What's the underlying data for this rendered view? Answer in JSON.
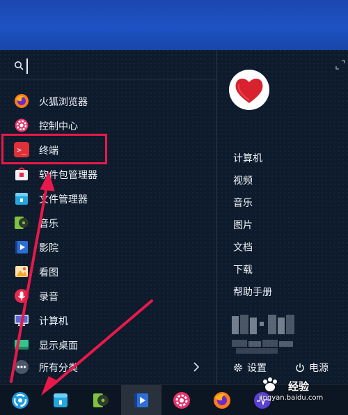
{
  "search": {
    "value": "",
    "placeholder": ""
  },
  "apps": [
    {
      "label": "火狐浏览器",
      "icon": "firefox-icon",
      "color": "#ff7a1a"
    },
    {
      "label": "控制中心",
      "icon": "gear-icon",
      "color": "#e5336b"
    },
    {
      "label": "终端",
      "icon": "terminal-icon",
      "color": "#e0303a"
    },
    {
      "label": "软件包管理器",
      "icon": "package-icon",
      "color": "#e8e8e8"
    },
    {
      "label": "文件管理器",
      "icon": "folder-icon",
      "color": "#22a6dd"
    },
    {
      "label": "音乐",
      "icon": "music-icon",
      "color": "#7dc241"
    },
    {
      "label": "影院",
      "icon": "movie-icon",
      "color": "#2d6fd8"
    },
    {
      "label": "看图",
      "icon": "image-viewer-icon",
      "color": "#f4a830"
    },
    {
      "label": "录音",
      "icon": "microphone-icon",
      "color": "#e8294d"
    },
    {
      "label": "计算机",
      "icon": "computer-icon",
      "color": "#5a6bd8"
    },
    {
      "label": "显示桌面",
      "icon": "desktop-icon",
      "color": "#36c48a"
    }
  ],
  "all_categories": {
    "label": "所有分类"
  },
  "places": [
    {
      "label": "计算机"
    },
    {
      "label": "视频"
    },
    {
      "label": "音乐"
    },
    {
      "label": "图片"
    },
    {
      "label": "文档"
    },
    {
      "label": "下载"
    },
    {
      "label": "帮助手册"
    }
  ],
  "footer": {
    "settings_label": "设置",
    "power_label": "电源"
  },
  "taskbar": [
    {
      "icon": "launcher-icon",
      "active": false
    },
    {
      "icon": "file-manager-icon",
      "active": false
    },
    {
      "icon": "music-icon",
      "active": false
    },
    {
      "icon": "movie-icon",
      "active": true
    },
    {
      "icon": "gear-icon",
      "active": false
    },
    {
      "icon": "firefox-icon",
      "active": false
    },
    {
      "icon": "monitor-icon",
      "active": false
    }
  ],
  "watermark": {
    "text": "经验",
    "url": "jingyan.baidu.com"
  },
  "colors": {
    "highlight": "#e8194a",
    "arrow": "#e8194a",
    "desktop": "#1e52c4"
  }
}
